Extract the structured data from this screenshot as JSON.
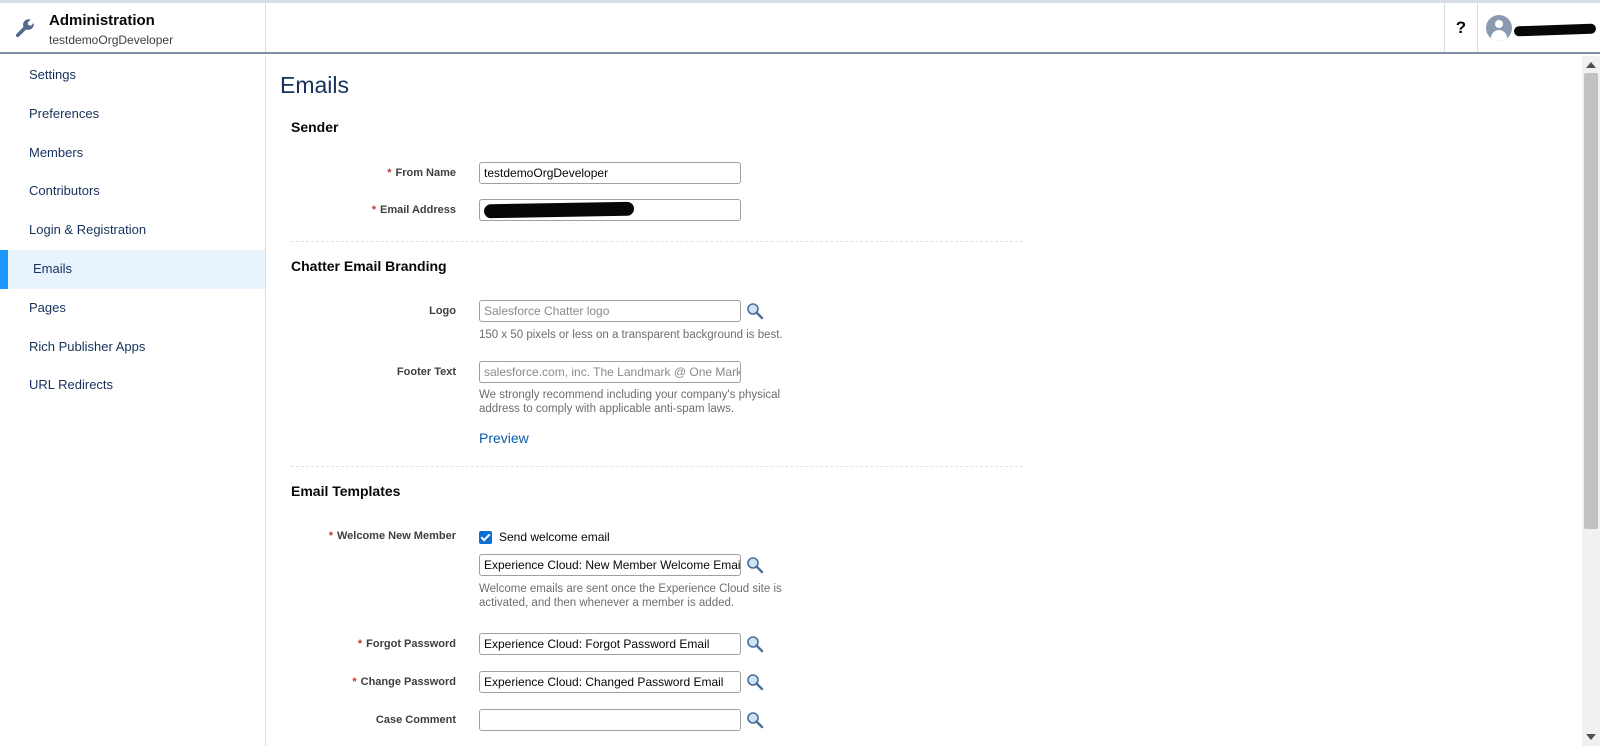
{
  "header": {
    "title": "Administration",
    "subtitle": "testdemoOrgDeveloper",
    "help_label": "?"
  },
  "sidebar": {
    "items": [
      {
        "label": "Settings",
        "active": false
      },
      {
        "label": "Preferences",
        "active": false
      },
      {
        "label": "Members",
        "active": false
      },
      {
        "label": "Contributors",
        "active": false
      },
      {
        "label": "Login & Registration",
        "active": false
      },
      {
        "label": "Emails",
        "active": true
      },
      {
        "label": "Pages",
        "active": false
      },
      {
        "label": "Rich Publisher Apps",
        "active": false
      },
      {
        "label": "URL Redirects",
        "active": false
      }
    ]
  },
  "main": {
    "title": "Emails",
    "sender": {
      "title": "Sender",
      "from_name_label": "From Name",
      "from_name_value": "testdemoOrgDeveloper",
      "email_label": "Email Address"
    },
    "branding": {
      "title": "Chatter Email Branding",
      "logo_label": "Logo",
      "logo_placeholder": "Salesforce Chatter logo",
      "logo_help": "150 x 50 pixels or less on a transparent background is best.",
      "footer_label": "Footer Text",
      "footer_placeholder": "salesforce.com, inc. The Landmark @ One Market",
      "footer_help": "We strongly recommend including your company's physical address to comply with applicable anti-spam laws.",
      "preview_label": "Preview"
    },
    "templates": {
      "title": "Email Templates",
      "welcome_label": "Welcome New Member",
      "welcome_checkbox_label": "Send welcome email",
      "welcome_checked": true,
      "welcome_value": "Experience Cloud: New Member Welcome Email",
      "welcome_help": "Welcome emails are sent once the Experience Cloud site is activated, and then whenever a member is added.",
      "forgot_label": "Forgot Password",
      "forgot_value": "Experience Cloud: Forgot Password Email",
      "change_label": "Change Password",
      "change_value": "Experience Cloud: Changed Password Email",
      "case_label": "Case Comment",
      "case_value": ""
    },
    "required_marker": "*"
  },
  "colors": {
    "accent": "#1b96ff",
    "link": "#0b5cab",
    "required": "#c23934",
    "active_bg": "#e8f3fd"
  }
}
